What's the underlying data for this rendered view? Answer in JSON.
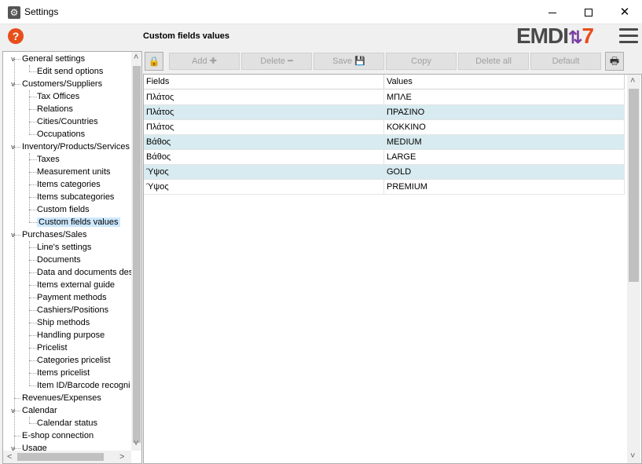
{
  "window": {
    "title": "Settings",
    "minimize": "—",
    "maximize": "☐",
    "close": "✕"
  },
  "header": {
    "help_icon": "?",
    "page_title": "Custom fields values",
    "logo_text_1": "EMDI",
    "logo_arrows": "⇅",
    "logo_text_2": "7"
  },
  "tree": {
    "nodes": [
      {
        "label": "General settings",
        "level": 0,
        "expander": "v"
      },
      {
        "label": "Edit send options",
        "level": 1
      },
      {
        "label": "Customers/Suppliers",
        "level": 0,
        "expander": "v"
      },
      {
        "label": "Tax Offices",
        "level": 1
      },
      {
        "label": "Relations",
        "level": 1
      },
      {
        "label": "Cities/Countries",
        "level": 1
      },
      {
        "label": "Occupations",
        "level": 1
      },
      {
        "label": "Inventory/Products/Services",
        "level": 0,
        "expander": "v"
      },
      {
        "label": "Taxes",
        "level": 1
      },
      {
        "label": "Measurement units",
        "level": 1
      },
      {
        "label": "Items categories",
        "level": 1
      },
      {
        "label": "Items subcategories",
        "level": 1
      },
      {
        "label": "Custom fields",
        "level": 1
      },
      {
        "label": "Custom fields values",
        "level": 1,
        "selected": true
      },
      {
        "label": "Purchases/Sales",
        "level": 0,
        "expander": "v"
      },
      {
        "label": "Line's settings",
        "level": 1
      },
      {
        "label": "Documents",
        "level": 1
      },
      {
        "label": "Data and documents des",
        "level": 1
      },
      {
        "label": "Items external guide",
        "level": 1
      },
      {
        "label": "Payment methods",
        "level": 1
      },
      {
        "label": "Cashiers/Positions",
        "level": 1
      },
      {
        "label": "Ship methods",
        "level": 1
      },
      {
        "label": "Handling purpose",
        "level": 1
      },
      {
        "label": "Pricelist",
        "level": 1
      },
      {
        "label": "Categories pricelist",
        "level": 1
      },
      {
        "label": "Items pricelist",
        "level": 1
      },
      {
        "label": "Item ID/Barcode recogni",
        "level": 1
      },
      {
        "label": "Revenues/Expenses",
        "level": 0
      },
      {
        "label": "Calendar",
        "level": 0,
        "expander": "v"
      },
      {
        "label": "Calendar status",
        "level": 1
      },
      {
        "label": "E-shop connection",
        "level": 0
      },
      {
        "label": "Usage",
        "level": 0,
        "expander": "v"
      }
    ],
    "scroll_up": "˄",
    "scroll_down": "˅",
    "scroll_left": "<",
    "scroll_right": ">"
  },
  "toolbar": {
    "lock_icon": "🔒",
    "buttons": [
      {
        "label": "Add ✚",
        "enabled": false
      },
      {
        "label": "Delete ━",
        "enabled": false
      },
      {
        "label": "Save 💾",
        "enabled": false
      },
      {
        "label": "Copy",
        "enabled": false
      },
      {
        "label": "Delete all",
        "enabled": false
      },
      {
        "label": "Default",
        "enabled": false
      }
    ],
    "print_icon": "🖶"
  },
  "grid": {
    "columns": [
      "Fields",
      "Values"
    ],
    "rows": [
      [
        "Πλάτος",
        "ΜΠΛΕ"
      ],
      [
        "Πλάτος",
        "ΠΡΑΣΙΝΟ"
      ],
      [
        "Πλάτος",
        "ΚΟΚΚΙΝΟ"
      ],
      [
        "Βάθος",
        "MEDIUM"
      ],
      [
        "Βάθος",
        "LARGE"
      ],
      [
        "Ύψος",
        "GOLD"
      ],
      [
        "Ύψος",
        "PREMIUM"
      ]
    ],
    "scroll_up": "˄",
    "scroll_down": "˅"
  }
}
